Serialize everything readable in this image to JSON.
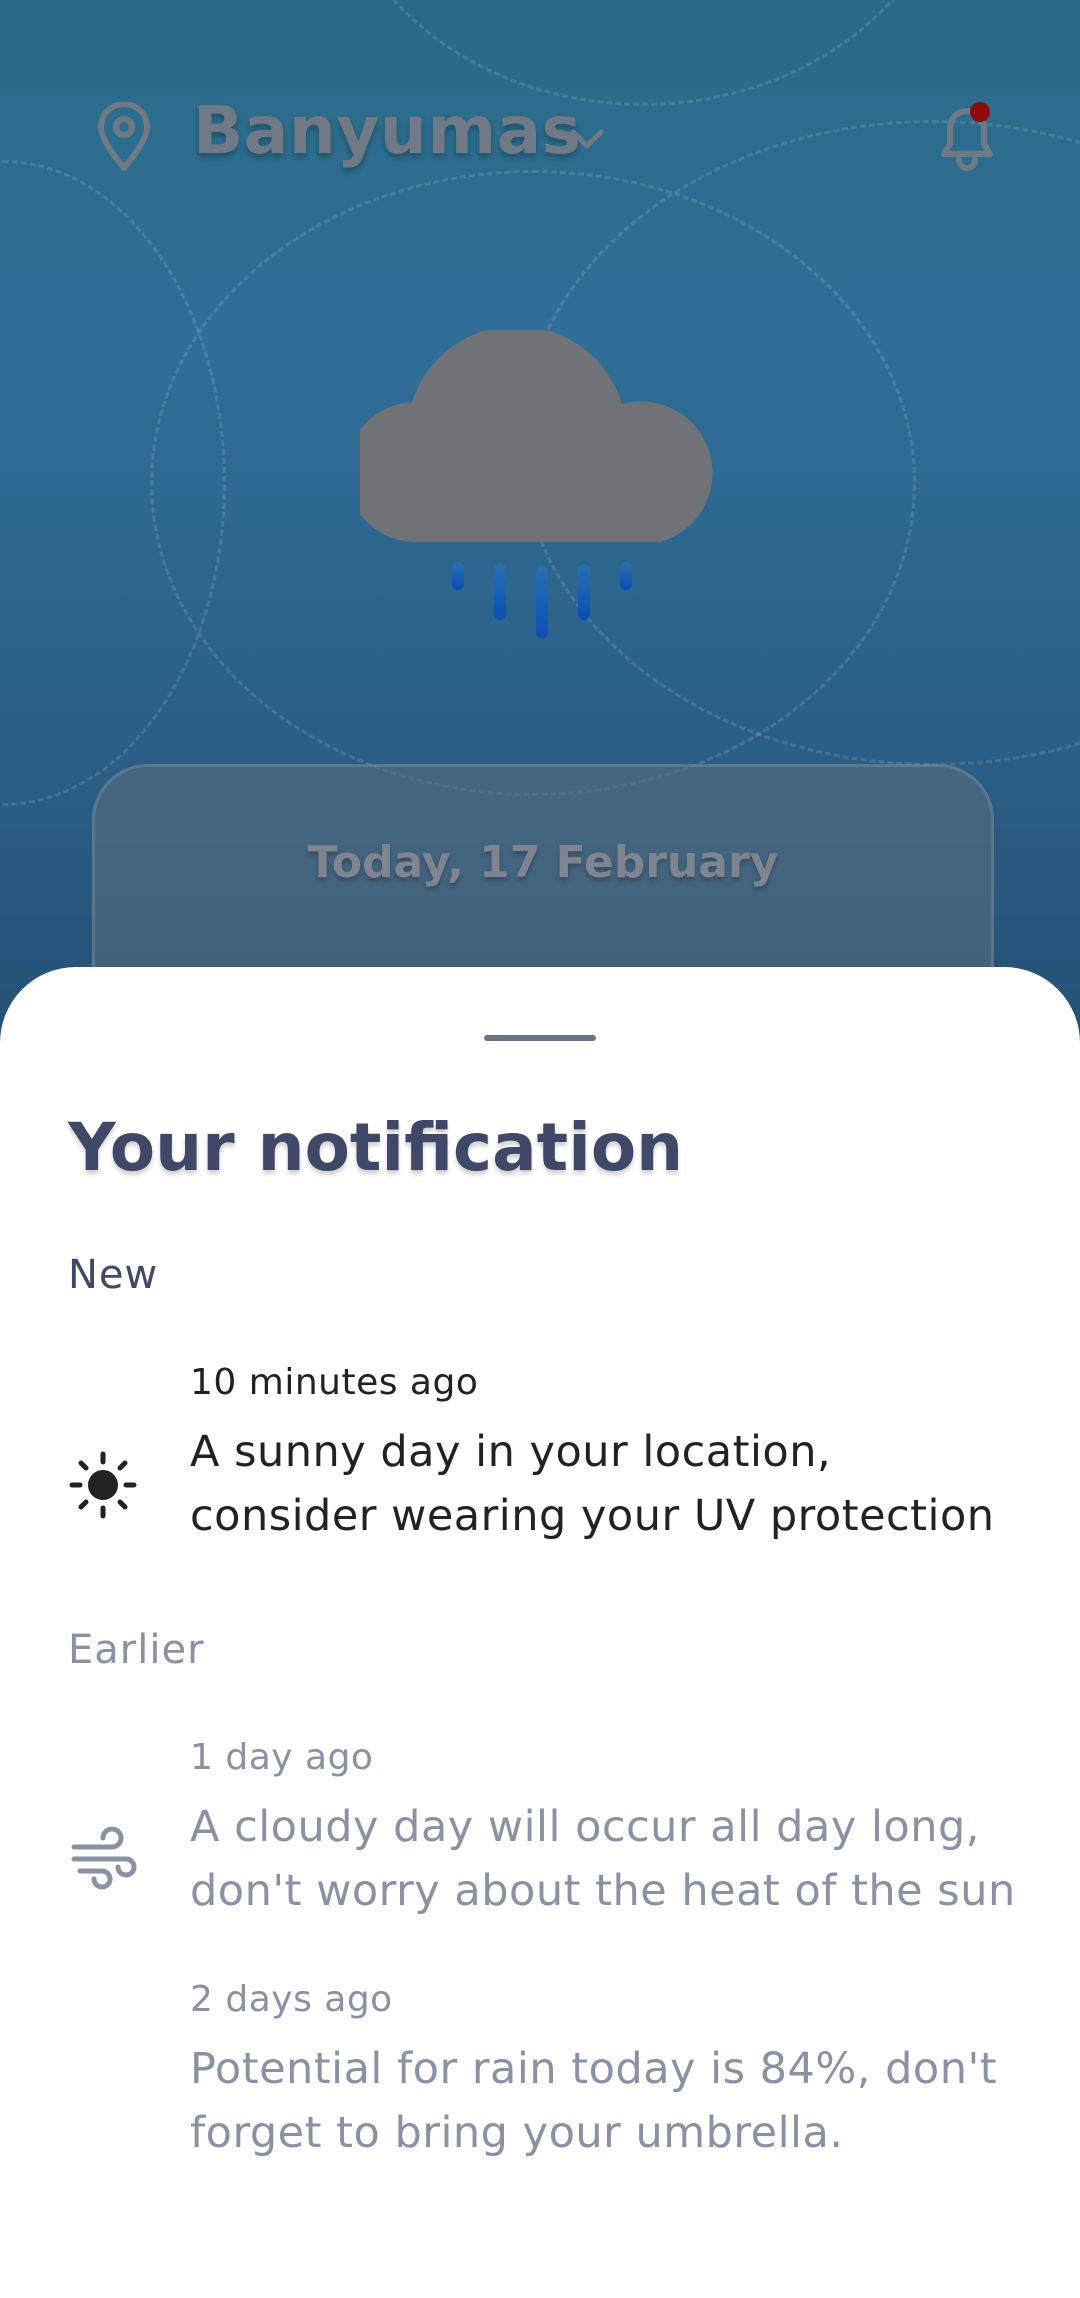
{
  "header": {
    "location": "Banyumas",
    "icons": [
      "location-pin-icon",
      "chevron-down-icon",
      "bell-icon"
    ],
    "bell_badge_color": "#8b0a0a"
  },
  "weather": {
    "icon": "rain-cloud-icon",
    "date": "Today, 17 February"
  },
  "sheet": {
    "title": "Your notification",
    "new_label": "New",
    "earlier_label": "Earlier",
    "new_items": [
      {
        "icon": "sun-icon",
        "time": "10 minutes ago",
        "message": "A sunny day in your location, consider wearing your UV protection"
      }
    ],
    "earlier_items": [
      {
        "icon": "wind-icon",
        "time": "1 day ago",
        "message": "A cloudy day will occur all day long, don't worry about the heat of the sun"
      },
      {
        "icon": "",
        "time": "2 days ago",
        "message": "Potential for rain today is 84%, don't forget to bring your umbrella."
      }
    ]
  },
  "colors": {
    "title": "#3f4867",
    "muted": "#8a91a3",
    "background_top": "#2a6a86",
    "background_bottom": "#244f73"
  }
}
